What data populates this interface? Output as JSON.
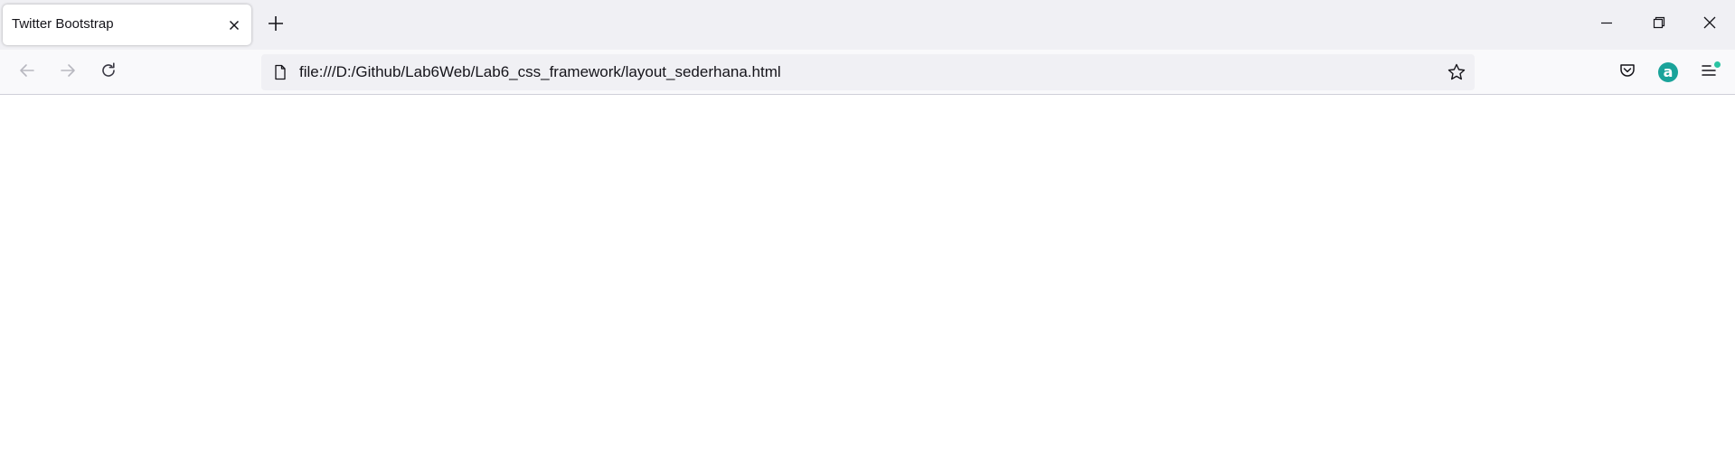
{
  "browser": {
    "tabs": [
      {
        "title": "Twitter Bootstrap",
        "active": true
      }
    ],
    "url": "file:///D:/Github/Lab6Web/Lab6_css_framework/layout_sederhana.html",
    "extension_badge": "a"
  },
  "icons": {
    "tab_close": "close-icon",
    "new_tab": "plus-icon",
    "minimize": "minimize-icon",
    "restore": "restore-icon",
    "window_close": "close-icon",
    "back": "arrow-left-icon",
    "forward": "arrow-right-icon",
    "reload": "reload-icon",
    "page": "page-icon",
    "bookmark": "star-icon",
    "pocket": "pocket-icon",
    "extension": "extension-icon",
    "menu": "hamburger-menu-icon"
  },
  "colors": {
    "tabstrip_bg": "#f0f0f4",
    "navbar_bg": "#f9f9fb",
    "urlbar_bg": "#f0f0f4",
    "text": "#15141a",
    "icon": "#5b5b66",
    "icon_disabled": "#b8b8c0",
    "accent_teal": "#1aa39a",
    "notification_dot": "#2ac3a2",
    "content_bg": "#ffffff"
  }
}
